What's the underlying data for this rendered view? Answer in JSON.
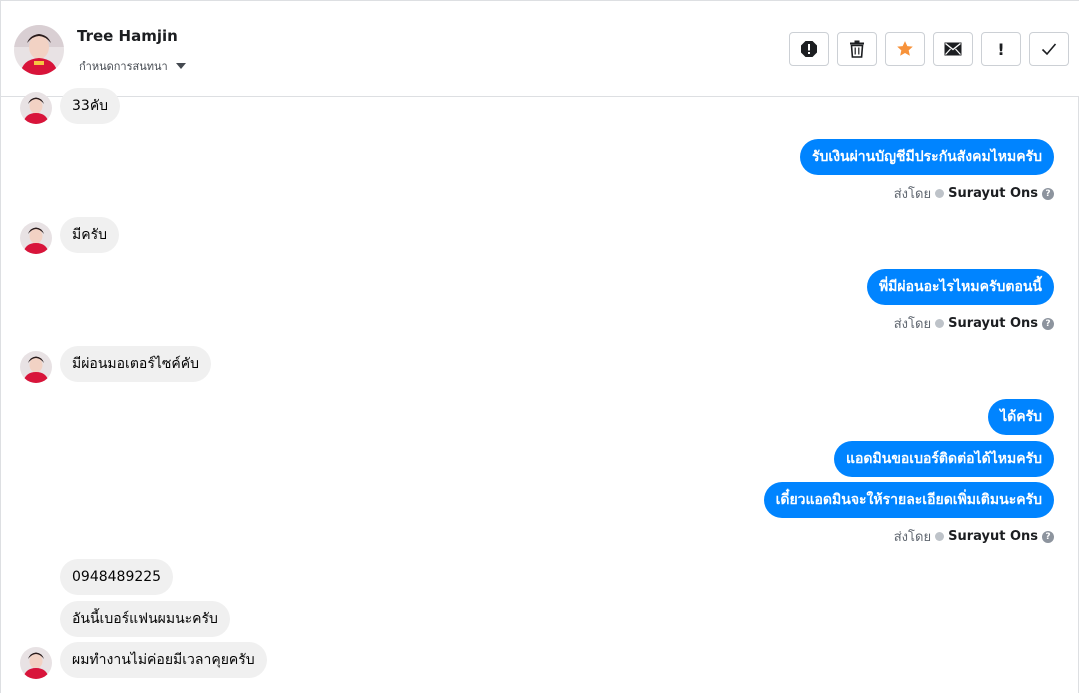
{
  "header": {
    "name": "Tree Hamjin",
    "subtitle": "กำหนดการสนทนา",
    "actions": {
      "spam_icon": "report-octagon-icon",
      "delete_icon": "trash-icon",
      "star_icon": "star-icon",
      "mail_icon": "envelope-icon",
      "important_label": "!",
      "done_icon": "checkmark-icon"
    },
    "star_color": "#f7923a"
  },
  "messages": {
    "in_1": "33คับ",
    "out_1": "รับเงินผ่านบัญชีมีประกันสังคมไหมครับ",
    "in_2": "มีครับ",
    "out_2": "พี่มีผ่อนอะไรไหมครับตอนนี้",
    "in_3": "มีผ่อนมอเตอร์ไซค์คับ",
    "out_3a": "ได้ครับ",
    "out_3b": "แอดมินขอเบอร์ติดต่อได้ไหมครับ",
    "out_3c": "เดี๋ยวแอดมินจะให้รายละเอียดเพิ่มเติมนะครับ",
    "in_4a": "0948489225",
    "in_4b": "อันนี้เบอร์แฟนผมนะครับ",
    "in_4c": "ผมทำงานไม่ค่อยมีเวลาคุยครับ"
  },
  "sent_by": {
    "prefix": "ส่งโดย",
    "name": "Surayut Ons",
    "help": "?"
  },
  "colors": {
    "outgoing_bubble": "#0084ff",
    "incoming_bubble": "#f0f0f0"
  }
}
